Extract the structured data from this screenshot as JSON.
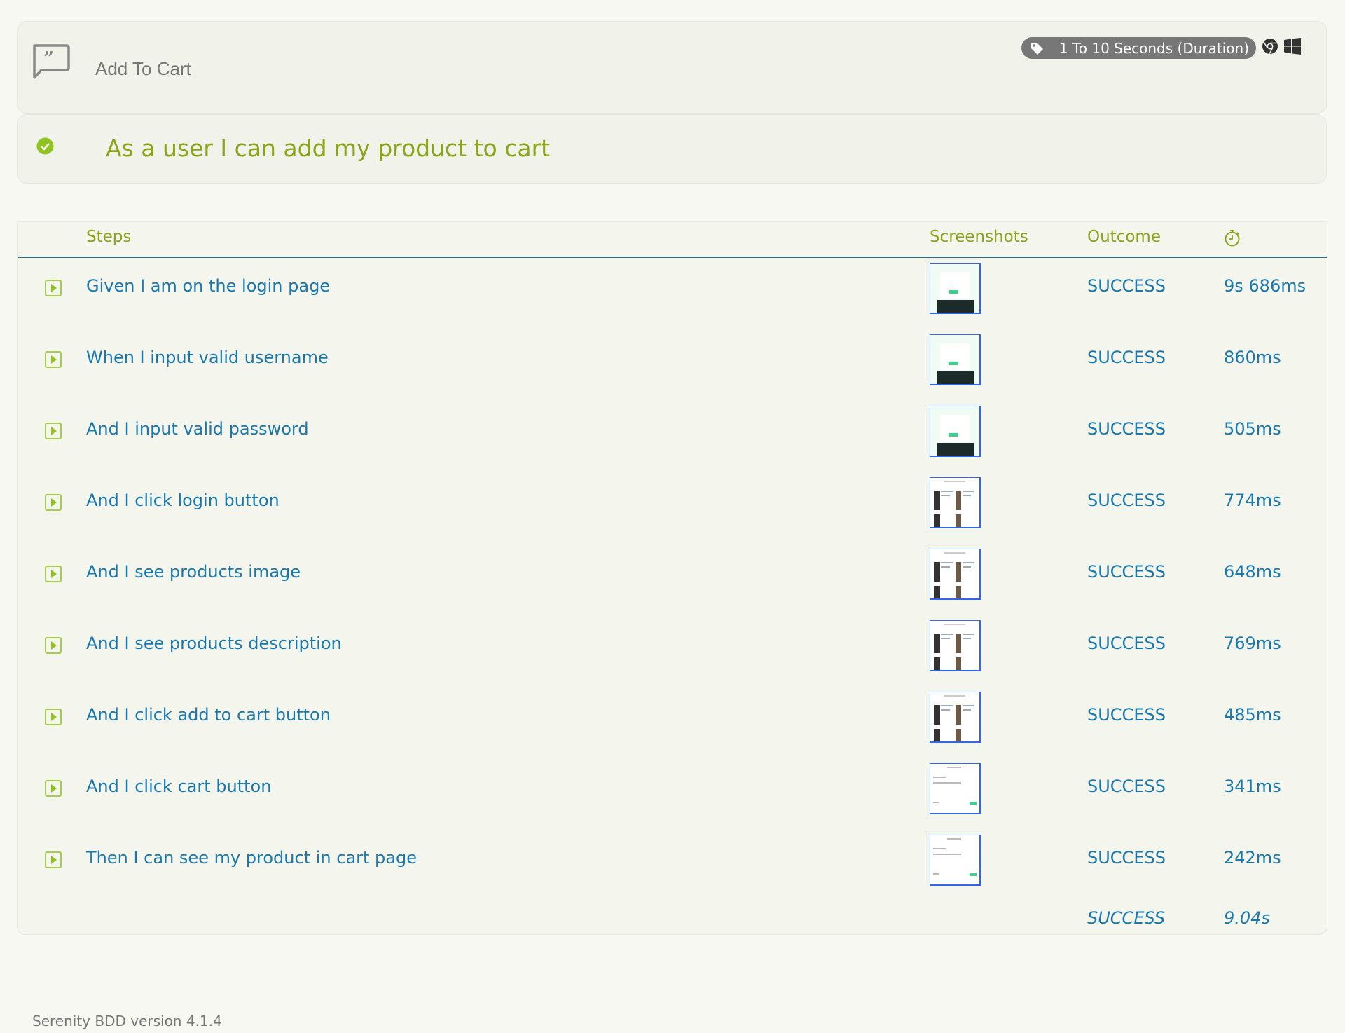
{
  "feature": {
    "title": "Add To Cart",
    "tag": "1 To 10 Seconds (Duration)",
    "icons": [
      "quote-icon",
      "tag-icon",
      "chrome-icon",
      "windows-icon"
    ]
  },
  "scenario": {
    "title": "As a user I can add my product to cart",
    "status": "success"
  },
  "table": {
    "headers": {
      "steps": "Steps",
      "screenshots": "Screenshots",
      "outcome": "Outcome",
      "duration_icon": "stopwatch-icon"
    },
    "rows": [
      {
        "step": "Given I am on the login page",
        "thumb": "login",
        "outcome": "SUCCESS",
        "duration": "9s 686ms"
      },
      {
        "step": "When I input valid username",
        "thumb": "login",
        "outcome": "SUCCESS",
        "duration": "860ms"
      },
      {
        "step": "And I input valid password",
        "thumb": "login",
        "outcome": "SUCCESS",
        "duration": "505ms"
      },
      {
        "step": "And I click login button",
        "thumb": "products",
        "outcome": "SUCCESS",
        "duration": "774ms"
      },
      {
        "step": "And I see products image",
        "thumb": "products",
        "outcome": "SUCCESS",
        "duration": "648ms"
      },
      {
        "step": "And I see products description",
        "thumb": "products",
        "outcome": "SUCCESS",
        "duration": "769ms"
      },
      {
        "step": "And I click add to cart button",
        "thumb": "products",
        "outcome": "SUCCESS",
        "duration": "485ms"
      },
      {
        "step": "And I click cart button",
        "thumb": "cart",
        "outcome": "SUCCESS",
        "duration": "341ms"
      },
      {
        "step": "Then I can see my product in cart page",
        "thumb": "cart",
        "outcome": "SUCCESS",
        "duration": "242ms"
      }
    ],
    "total": {
      "outcome": "SUCCESS",
      "duration": "9.04s"
    }
  },
  "footer": {
    "version": "Serenity BDD version 4.1.4"
  },
  "colors": {
    "green": "#8aa51a",
    "blue": "#1a78ad",
    "grey": "#777777"
  }
}
